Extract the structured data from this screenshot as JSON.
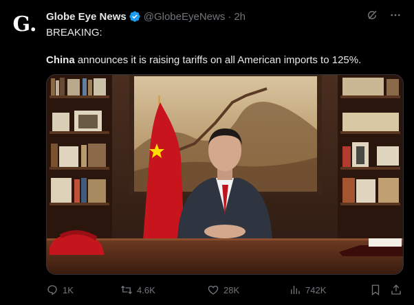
{
  "author": {
    "name": "Globe Eye News",
    "handle": "@GlobeEyeNews",
    "separator": "·",
    "time": "2h",
    "avatar_letter": "G."
  },
  "post": {
    "line1": "BREAKING:",
    "bold_word": "China",
    "line2_rest": " announces it is raising tariffs on all American imports to 125%."
  },
  "actions": {
    "replies": "1K",
    "reposts": "4.6K",
    "likes": "28K",
    "views": "742K"
  },
  "colors": {
    "background": "#000000",
    "text": "#e7e9ea",
    "muted": "#71767b",
    "verified": "#1d9bf0"
  },
  "icons": [
    "verified-badge-icon",
    "grok-icon",
    "more-icon",
    "reply-icon",
    "repost-icon",
    "like-icon",
    "views-icon",
    "bookmark-icon",
    "share-icon"
  ]
}
